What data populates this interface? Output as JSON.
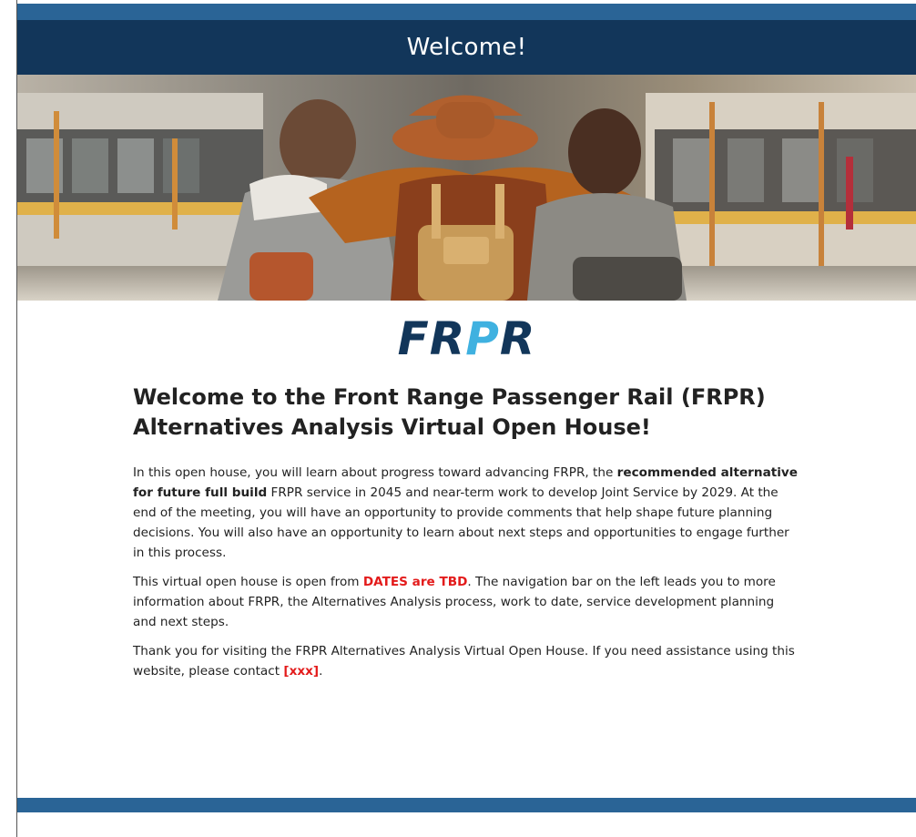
{
  "header": {
    "title": "Welcome!"
  },
  "logo": {
    "letters": [
      "F",
      "R",
      "P",
      "R"
    ],
    "colors": {
      "dark": "#12365a",
      "accent": "#3fb1e0"
    }
  },
  "main": {
    "heading": "Welcome to the Front Range Passenger Rail (FRPR) Alternatives Analysis Virtual Open House!",
    "para1": {
      "part1": "In this open house, you will learn about progress toward advancing FRPR, the ",
      "bold": "recommended alternative for future full build",
      "part2": " FRPR service in 2045 and near-term work to develop Joint Service by 2029. At the end of the meeting, you will have an opportunity to provide comments that help shape future planning decisions. You will also have an opportunity to learn about next steps and opportunities to engage further in this process."
    },
    "para2": {
      "part1": "This virtual open house is open from ",
      "highlight": "DATES are TBD",
      "part2": ". The navigation bar on the left leads you to more information about FRPR, the Alternatives Analysis process, work to date, service development planning and next steps."
    },
    "para3": {
      "part1": "Thank you for visiting the FRPR Alternatives Analysis Virtual Open House. If you need assistance using this website, please contact ",
      "highlight": "[xxx]",
      "part2": "."
    }
  },
  "colors": {
    "header_bg": "#12365a",
    "strip": "#2a6496",
    "highlight": "#e31b1b"
  }
}
